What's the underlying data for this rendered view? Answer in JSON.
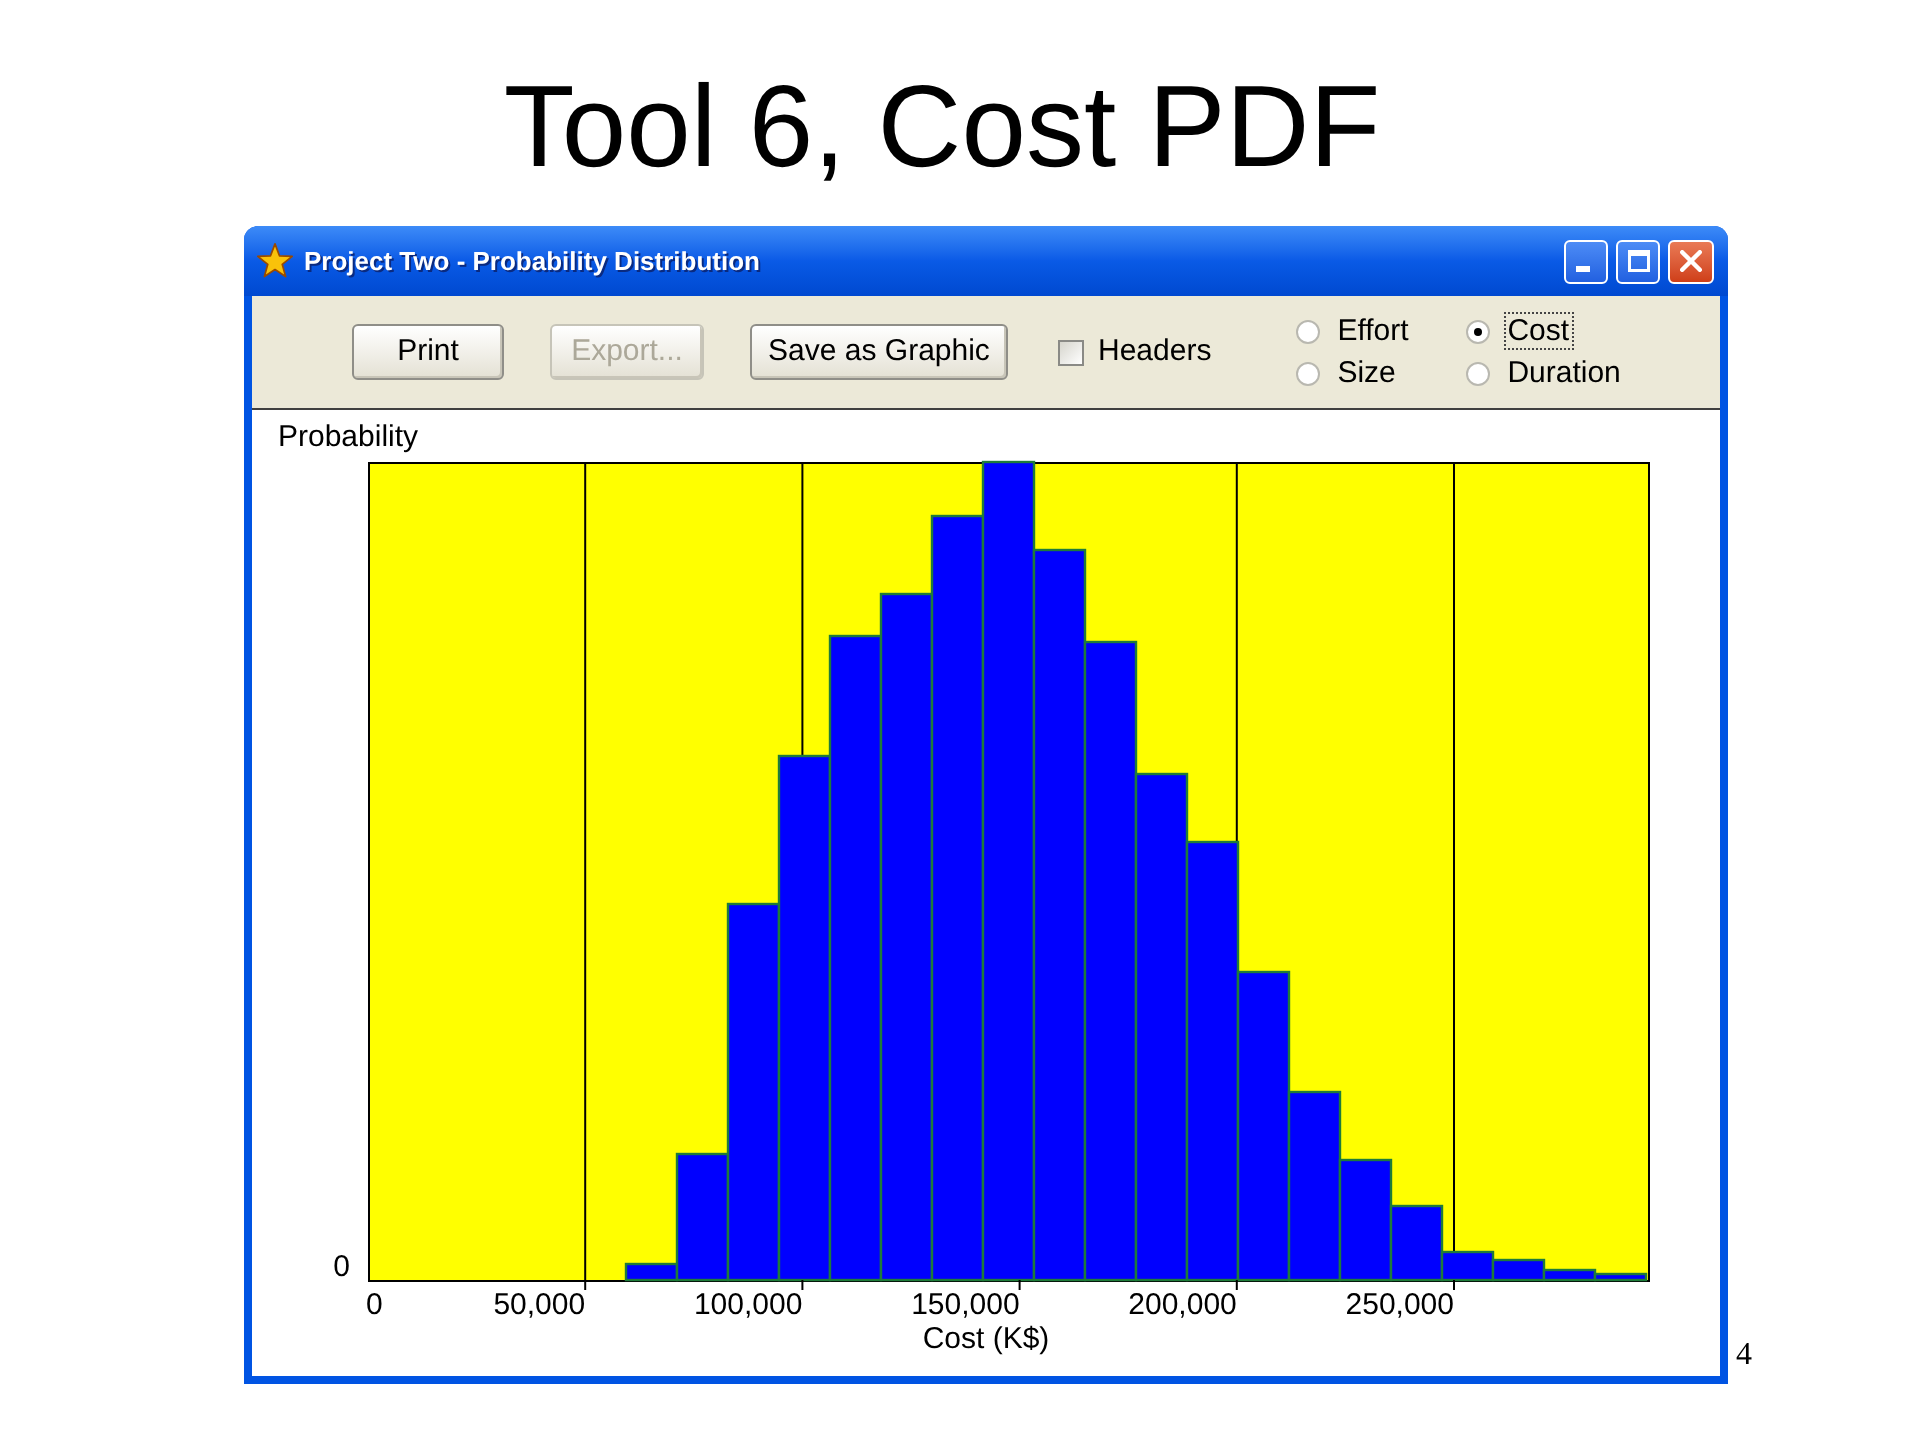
{
  "slide": {
    "title": "Tool 6, Cost PDF",
    "page_number": "4"
  },
  "window": {
    "title": "Project Two - Probability Distribution"
  },
  "toolbar": {
    "buttons": [
      {
        "label": "Print",
        "disabled": false
      },
      {
        "label": "Export...",
        "disabled": true
      },
      {
        "label": "Save as Graphic",
        "disabled": false
      }
    ],
    "headers_checkbox": {
      "label": "Headers",
      "checked": false
    },
    "radios": [
      {
        "label": "Effort",
        "selected": false
      },
      {
        "label": "Cost",
        "selected": true
      },
      {
        "label": "Size",
        "selected": false
      },
      {
        "label": "Duration",
        "selected": false
      }
    ]
  },
  "chart": {
    "y_axis_label": "Probability",
    "y_tick": "0",
    "x_ticks": [
      "0",
      "50,000",
      "100,000",
      "150,000",
      "200,000",
      "250,000"
    ],
    "x_axis_label": "Cost (K$)"
  }
}
